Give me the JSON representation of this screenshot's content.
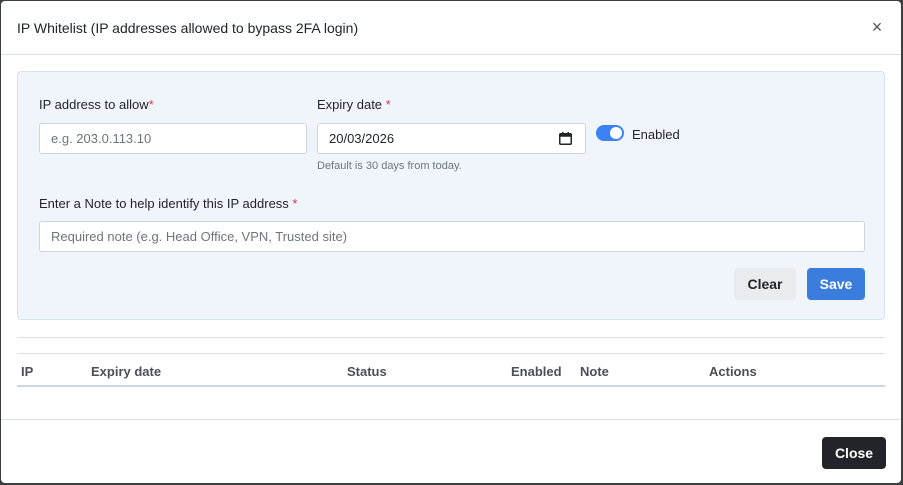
{
  "modal": {
    "title": "IP Whitelist (IP addresses allowed to bypass 2FA login)",
    "close_symbol": "×"
  },
  "form": {
    "ip_label": "IP address to allow",
    "ip_required": "*",
    "ip_placeholder": "e.g. 203.0.113.10",
    "ip_value": "",
    "expiry_label": "Expiry date ",
    "expiry_required": "*",
    "expiry_value": "20/03/2026",
    "expiry_help": "Default is 30 days from today.",
    "enabled_label": "Enabled",
    "enabled": true,
    "note_label": "Enter a Note to help identify this IP address ",
    "note_required": "*",
    "note_placeholder": "Required note (e.g. Head Office, VPN, Trusted site)",
    "note_value": "",
    "clear_label": "Clear",
    "save_label": "Save"
  },
  "table": {
    "columns": [
      "IP",
      "Expiry date",
      "Status",
      "Enabled",
      "Note",
      "Actions"
    ],
    "rows": []
  },
  "footer": {
    "close_label": "Close"
  },
  "colors": {
    "accent": "#3b7ddd",
    "toggle_on": "#3b82f6",
    "required": "#dc3545",
    "panel_bg": "#f0f5fb"
  },
  "icons": {
    "close": "close-icon",
    "calendar": "calendar-icon"
  }
}
